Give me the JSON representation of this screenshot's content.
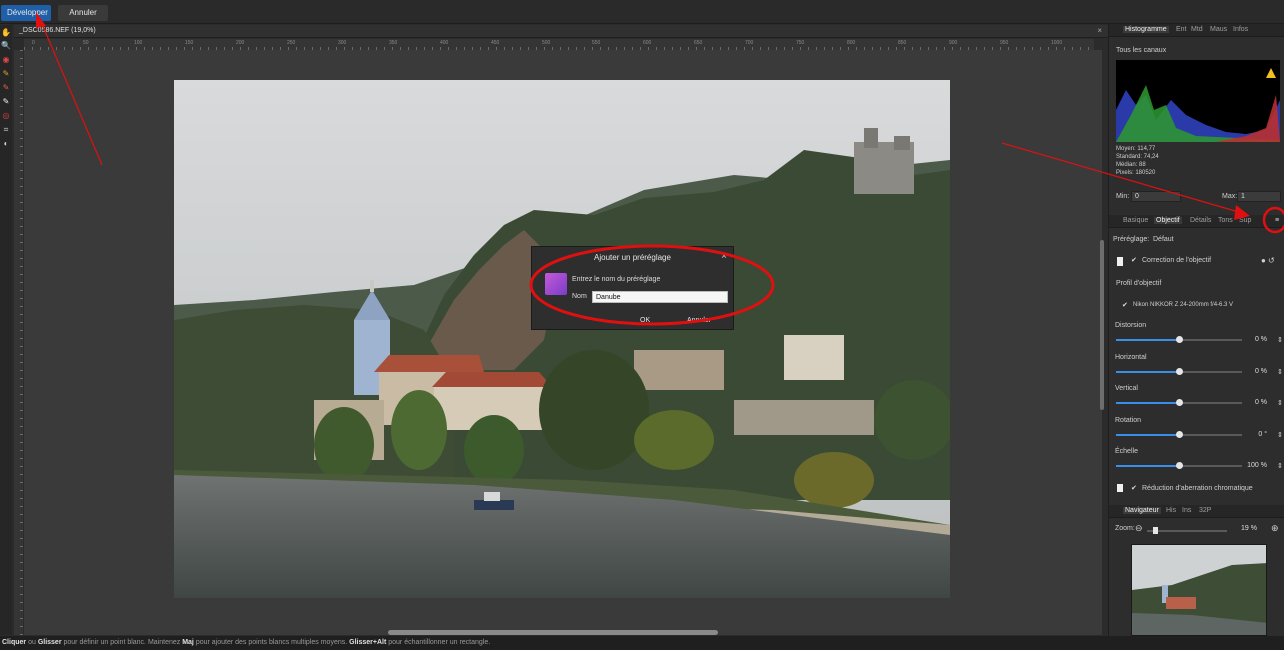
{
  "toolbar": {
    "develop_label": "Développer",
    "cancel_label": "Annuler"
  },
  "document": {
    "title": "_DSC0586.NEF (19,0%)",
    "close_glyph": "×"
  },
  "ruler": {
    "ticks": [
      "0",
      "50",
      "100",
      "150",
      "200",
      "250",
      "300",
      "350",
      "400",
      "450",
      "500",
      "550",
      "600",
      "650",
      "700",
      "750",
      "800",
      "850",
      "900",
      "950",
      "1000"
    ]
  },
  "tools": [
    "hand-icon",
    "zoom-icon",
    "red-eye-icon",
    "brush-icon",
    "blemish-icon",
    "clone-icon",
    "overlay-icon",
    "crop-icon",
    "white-balance-icon"
  ],
  "dialog": {
    "title": "Ajouter un préréglage",
    "prompt": "Entrez le nom du préréglage",
    "name_label": "Nom",
    "name_value": "Danube",
    "ok": "OK",
    "cancel": "Annuler",
    "close": "×"
  },
  "histogram_panel": {
    "tabs": [
      "Histogramme",
      "Ent",
      "Mtd",
      "Maus",
      "Infos"
    ],
    "channel": "Tous les canaux",
    "stats": {
      "mean": "Moyen: 114,77",
      "std": "Standard: 74,24",
      "median": "Médian: 88",
      "pixels": "Pixels: 180520"
    },
    "min_label": "Min:",
    "min_value": "0",
    "max_label": "Max:",
    "max_value": "1"
  },
  "develop_panel": {
    "tabs": [
      "Basique",
      "Objectif",
      "Détails",
      "Tons",
      "Sup"
    ],
    "preset_label": "Préréglage:",
    "preset_value": "Défaut",
    "lens_correction": "Correction de l'objectif",
    "lens_profile_label": "Profil d'objectif",
    "lens_profile_value": "Nikon NIKKOR Z 24-200mm f/4-6.3 V",
    "sliders": [
      {
        "label": "Distorsion",
        "value": "0 %",
        "level": 0.5
      },
      {
        "label": "Horizontal",
        "value": "0 %",
        "level": 0.5
      },
      {
        "label": "Vertical",
        "value": "0 %",
        "level": 0.5
      },
      {
        "label": "Rotation",
        "value": "0 °",
        "level": 0.5
      },
      {
        "label": "Échelle",
        "value": "100 %",
        "level": 0.5
      }
    ],
    "chromatic": "Réduction d'aberration chromatique"
  },
  "navigator_panel": {
    "tabs": [
      "Navigateur",
      "His",
      "Ins",
      "32P"
    ],
    "zoom_label": "Zoom:",
    "zoom_value": "19 %"
  },
  "status": {
    "k1": "Cliquer",
    "t1": " ou ",
    "k2": "Glisser",
    "t2": " pour définir un point blanc. Maintenez ",
    "k3": "Maj",
    "t3": " pour ajouter des points blancs multiples moyens. ",
    "k4": "Glisser+Alt",
    "t4": " pour échantillonner un rectangle."
  },
  "colors": {
    "accent": "#1f5fa8",
    "annotation": "#e01010",
    "slider": "#3a8ee6"
  }
}
